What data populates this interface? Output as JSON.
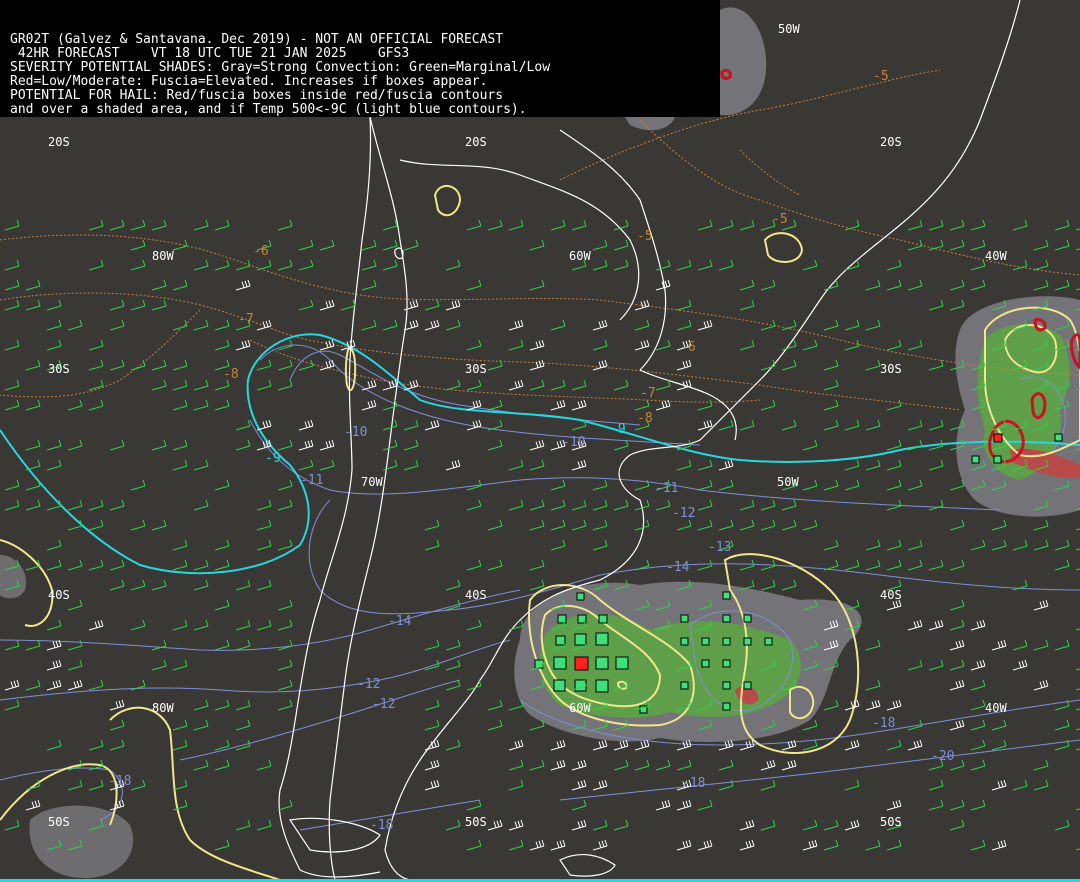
{
  "header": {
    "line1": "GR02T (Galvez & Santavana. Dec 2019) - NOT AN OFFICIAL FORECAST",
    "line2": " 42HR FORECAST    VT 18 UTC TUE 21 JAN 2025    GFS3",
    "line3": "SEVERITY POTENTIAL SHADES: Gray=Strong Convection: Green=Marginal/Low",
    "line4": "Red=Low/Moderate: Fuscia=Elevated. Increases if boxes appear.",
    "line5": "POTENTIAL FOR HAIL: Red/fuscia boxes inside red/fuscia contours",
    "line6": "and over a shaded area, and if Temp 500<-9C (light blue contours)."
  },
  "grid_labels": {
    "lat_20s": "20S",
    "lat_30s": "30S",
    "lat_40s": "40S",
    "lat_50s": "50S",
    "lon_80w": "80W",
    "lon_70w": "70W",
    "lon_60w": "60W",
    "lon_50w": "50W",
    "lon_40w": "40W"
  },
  "contour_labels": {
    "orange": [
      "-5",
      "-5",
      "-5",
      "-6",
      "-6",
      "-7",
      "-7",
      "-8",
      "-8"
    ],
    "cyan": [
      "-9",
      "-9"
    ],
    "blue": [
      "-10",
      "-10",
      "-11",
      "-11",
      "-12",
      "-12",
      "-12",
      "-13",
      "-14",
      "-14",
      "-18",
      "-18",
      "-18",
      "-20",
      "-18"
    ]
  },
  "colors": {
    "background": "#3a3834",
    "coastline": "#ffffff",
    "gray_shade": "#7a7a80",
    "green_shade": "#5f9f4a",
    "red_shade": "#b84a4a",
    "yellow_contour": "#f0e68c",
    "cyan_contour": "#26d6e0",
    "blue_contour": "#7f8fd8",
    "orange_contour": "#c8823c",
    "box_green": "#3fe07a",
    "box_red": "#ff2020",
    "wind_barb_green": "#2fd34a",
    "wind_barb_white": "#ffffff"
  }
}
